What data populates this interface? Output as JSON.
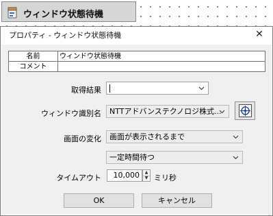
{
  "canvas": {
    "node_label": "ウィンドウ状態待機"
  },
  "dialog": {
    "title": "プロパティ - ウィンドウ状態待機",
    "close_glyph": "✕",
    "grid": {
      "rows": [
        {
          "key": "名前",
          "value": "ウィンドウ状態待機"
        },
        {
          "key": "コメント",
          "value": ""
        }
      ]
    },
    "acquisition_result": {
      "label": "取得結果",
      "value": ""
    },
    "window_id": {
      "label": "ウィンドウ識別名",
      "value": "NTTアドバンステクノロジ株式..."
    },
    "screen_change": {
      "label": "画面の変化",
      "value": "画面が表示されるまで",
      "wait_mode": "一定時間待つ"
    },
    "timeout": {
      "label": "タイムアウト",
      "value": "10,000",
      "unit": "ミリ秒"
    },
    "buttons": {
      "ok": "OK",
      "cancel": "キャンセル"
    }
  },
  "icons": {
    "node": "window-wait-icon",
    "target": "window-target-icon",
    "dropdown": "chevron-down-icon",
    "close": "close-icon",
    "spin_up": "spin-up-icon",
    "spin_down": "spin-down-icon"
  }
}
